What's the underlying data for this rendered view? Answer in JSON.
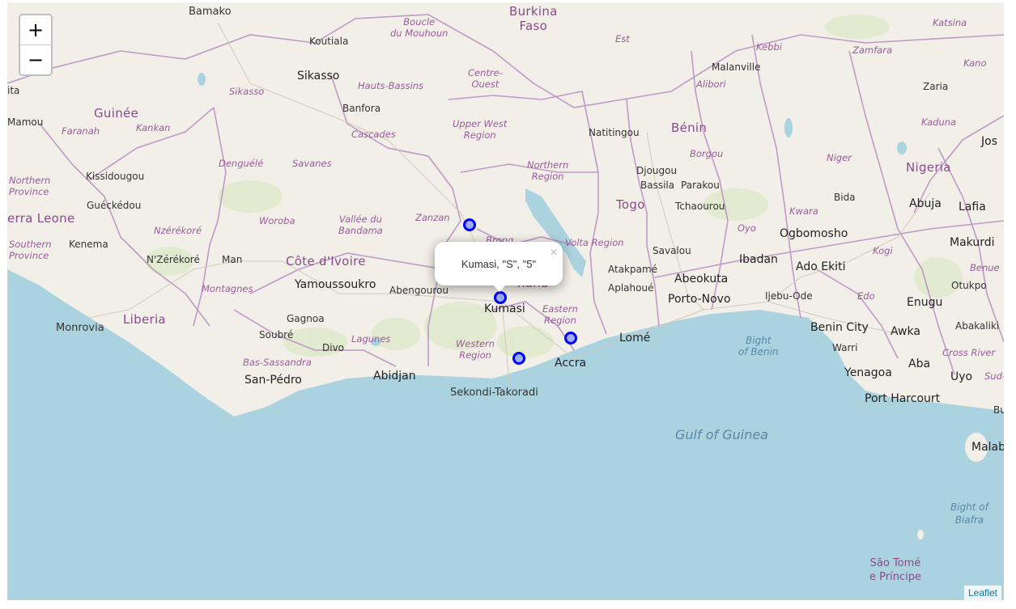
{
  "zoom": {
    "in_label": "+",
    "out_label": "−"
  },
  "attribution": {
    "link": "Leaflet"
  },
  "popup": {
    "text": "Kumasi, \"S\", \"5\"",
    "close": "×"
  },
  "markers": [
    {
      "name": "marker-north"
    },
    {
      "name": "marker-kumasi"
    },
    {
      "name": "marker-south"
    },
    {
      "name": "marker-accra"
    }
  ],
  "labels": {
    "countries": {
      "burkina_faso": "Burkina\nFaso",
      "guinee": "Guinée",
      "cote_divoire": "Côte d'Ivoire",
      "liberia": "Liberia",
      "sierra_leone": "erra Leone",
      "togo": "Togo",
      "benin": "Bénin",
      "nigeria": "Nigeria",
      "ghana": "hana"
    },
    "cities": {
      "bamako": "Bamako",
      "koutiala": "Koutiala",
      "sikasso": "Sikasso",
      "banfora": "Banfora",
      "kissidougou": "Kissidougou",
      "guekedou": "Guéckédou",
      "kenema": "Kenema",
      "nzerekore": "N'Zérékoré",
      "man": "Man",
      "yamoussoukro": "Yamoussoukro",
      "abengourou": "Abengourou",
      "kumasi": "Kumasi",
      "monrovia": "Monrovia",
      "gagnoa": "Gagnoa",
      "soubre": "Soubré",
      "divo": "Divo",
      "san_pedro": "San-Pédro",
      "abidjan": "Abidjan",
      "sekondi": "Sekondi-Takoradi",
      "accra": "Accra",
      "lome": "Lomé",
      "natitingou": "Natitingou",
      "djougou": "Djougou",
      "bassila": "Bassila",
      "parakou": "Parakou",
      "tchaourou": "Tchaourou",
      "savalou": "Savalou",
      "atakpame": "Atakpamé",
      "aplahoue": "Aplahoué",
      "abeokuta": "Abeokuta",
      "porto_novo": "Porto-Novo",
      "ibadan": "Ibadan",
      "ijebu_ode": "Ijebu-Ode",
      "ogbomosho": "Ogbomosho",
      "ado_ekiti": "Ado Ekiti",
      "benin_city": "Benin City",
      "awka": "Awka",
      "enugu": "Enugu",
      "abakaliki": "Abakaliki",
      "warri": "Warri",
      "yenagoa": "Yenagoa",
      "aba": "Aba",
      "uyo": "Uyo",
      "port_harcourt": "Port Harcourt",
      "malanville": "Malanville",
      "zaria": "Zaria",
      "jos": "Jos",
      "abuja": "Abuja",
      "lafia": "Lafia",
      "bida": "Bida",
      "makurdi": "Makurdi",
      "otukpo": "Otukpo",
      "malabo": "Malabo",
      "sao_tome": "São Tomé\ne Príncipe",
      "mamou": "Mamou",
      "ita": "ita",
      "bu": "Bu"
    },
    "regions": {
      "boucle": "Boucle\ndu Mouhoun",
      "centre_ouest": "Centre-\nOuest",
      "est": "Est",
      "hauts_bassins": "Hauts-Bassins",
      "sikasso_r": "Sikasso",
      "cascades": "Cascades",
      "faranah": "Faranah",
      "kankan": "Kankan",
      "upper_west": "Upper West\nRegion",
      "northern": "Northern\nRegion",
      "denguele": "Denguélé",
      "savanes": "Savanes",
      "northern_prov": "Northern\nProvince",
      "woroba": "Woroba",
      "vallee": "Vallée du\nBandama",
      "zanzan": "Zanzan",
      "southern_prov": "Southern\nProvince",
      "nzerekore_r": "Nzérékoré",
      "montagnes": "Montagnes",
      "brong": "Brong",
      "volta": "Volta Region",
      "eastern": "Eastern\nRegion",
      "western": "Western\nRegion",
      "lagunes": "Lagunes",
      "bas_sassandra": "Bas-Sassandra",
      "kebbi": "Kebbi",
      "zamfara": "Zamfara",
      "katsina": "Katsina",
      "kano": "Kano",
      "alibori": "Alibori",
      "borgou": "Borgou",
      "kaduna": "Kaduna",
      "niger": "Niger",
      "kwara": "Kwara",
      "oyo": "Oyo",
      "kogi": "Kogi",
      "benue": "Benue",
      "edo": "Edo",
      "cross_river": "Cross River",
      "sud": "Sud-"
    },
    "water": {
      "gulf": "Gulf of Guinea",
      "bight_benin": "Bight\nof Benin",
      "bight_biafra": "Bight of\nBiafra"
    }
  },
  "colors": {
    "land": "#f2efe9",
    "sea": "#aad3df",
    "border": "#b58cc0",
    "marker": "#0000ff"
  }
}
